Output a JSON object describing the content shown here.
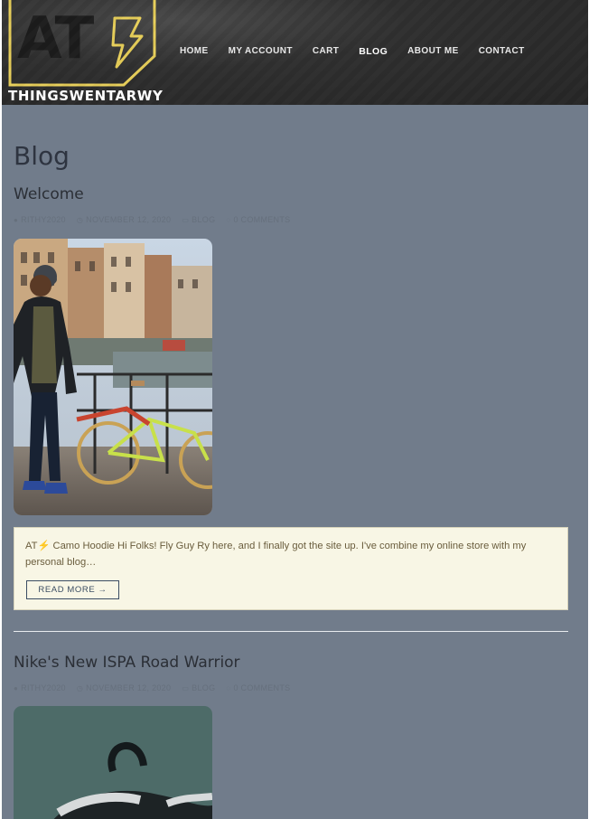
{
  "header": {
    "logo_letters": "AT",
    "logo_name": "THINGSWENTARWY",
    "nav": [
      {
        "label": "HOME",
        "active": false
      },
      {
        "label": "MY ACCOUNT",
        "active": false
      },
      {
        "label": "CART",
        "active": false
      },
      {
        "label": "BLOG",
        "active": true
      },
      {
        "label": "ABOUT ME",
        "active": false
      },
      {
        "label": "CONTACT",
        "active": false
      }
    ]
  },
  "main": {
    "page_title": "Blog",
    "posts": [
      {
        "title": "Welcome",
        "meta": {
          "author": "RITHY2020",
          "date": "NOVEMBER 12, 2020",
          "category": "BLOG",
          "comments": "0 COMMENTS"
        },
        "excerpt": "AT⚡ Camo Hoodie Hi Folks! Fly Guy Ry here, and I finally got the site up. I've combine my online store with my personal blog…",
        "read_more": "READ MORE →"
      },
      {
        "title": "Nike's New ISPA Road Warrior",
        "meta": {
          "author": "RITHY2020",
          "date": "NOVEMBER 12, 2020",
          "category": "BLOG",
          "comments": "0 COMMENTS"
        }
      }
    ]
  },
  "colors": {
    "page_bg": "#717c8b",
    "header_bg": "#2f2f2f",
    "logo_accent": "#e8cf5a",
    "excerpt_bg": "#f8f6e5",
    "button_border": "#3b4d63"
  },
  "icons": [
    "user-icon",
    "clock-icon",
    "folder-icon",
    "comment-icon"
  ]
}
